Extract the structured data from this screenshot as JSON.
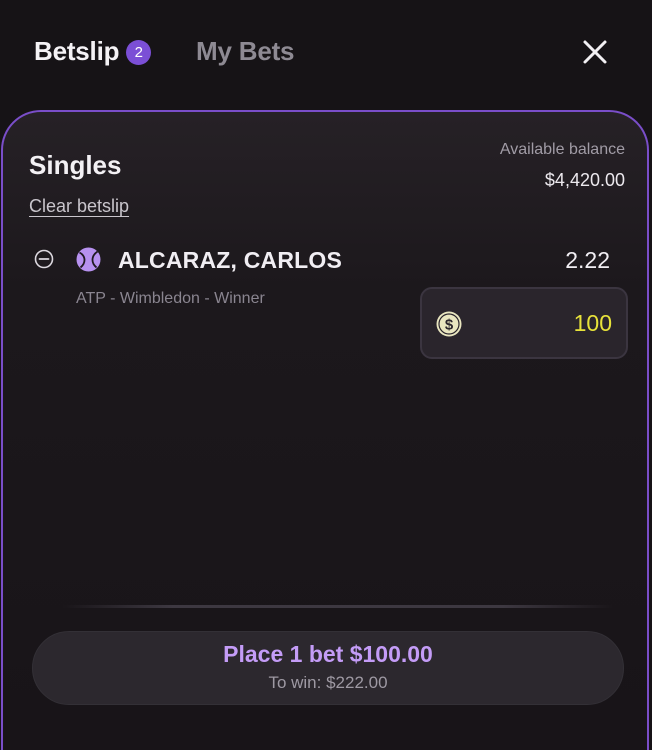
{
  "header": {
    "tab_betslip": "Betslip",
    "betslip_count": "2",
    "tab_mybets": "My Bets"
  },
  "betslip": {
    "section_title": "Singles",
    "clear_label": "Clear betslip",
    "balance_label": "Available balance",
    "balance_value": "$4,420.00",
    "selections": [
      {
        "name": "ALCARAZ, CARLOS",
        "odds": "2.22",
        "market": "ATP - Wimbledon - Winner",
        "stake": "100",
        "sport_icon": "tennis-ball-icon"
      }
    ]
  },
  "footer": {
    "place_bet_label": "Place 1 bet $100.00",
    "to_win_label": "To win: $222.00"
  },
  "colors": {
    "accent": "#7b4fd6",
    "panel_border": "#7a4ec9",
    "stake_text": "#e7e23a",
    "place_bet_text": "#c49cf7",
    "background": "#161316"
  }
}
